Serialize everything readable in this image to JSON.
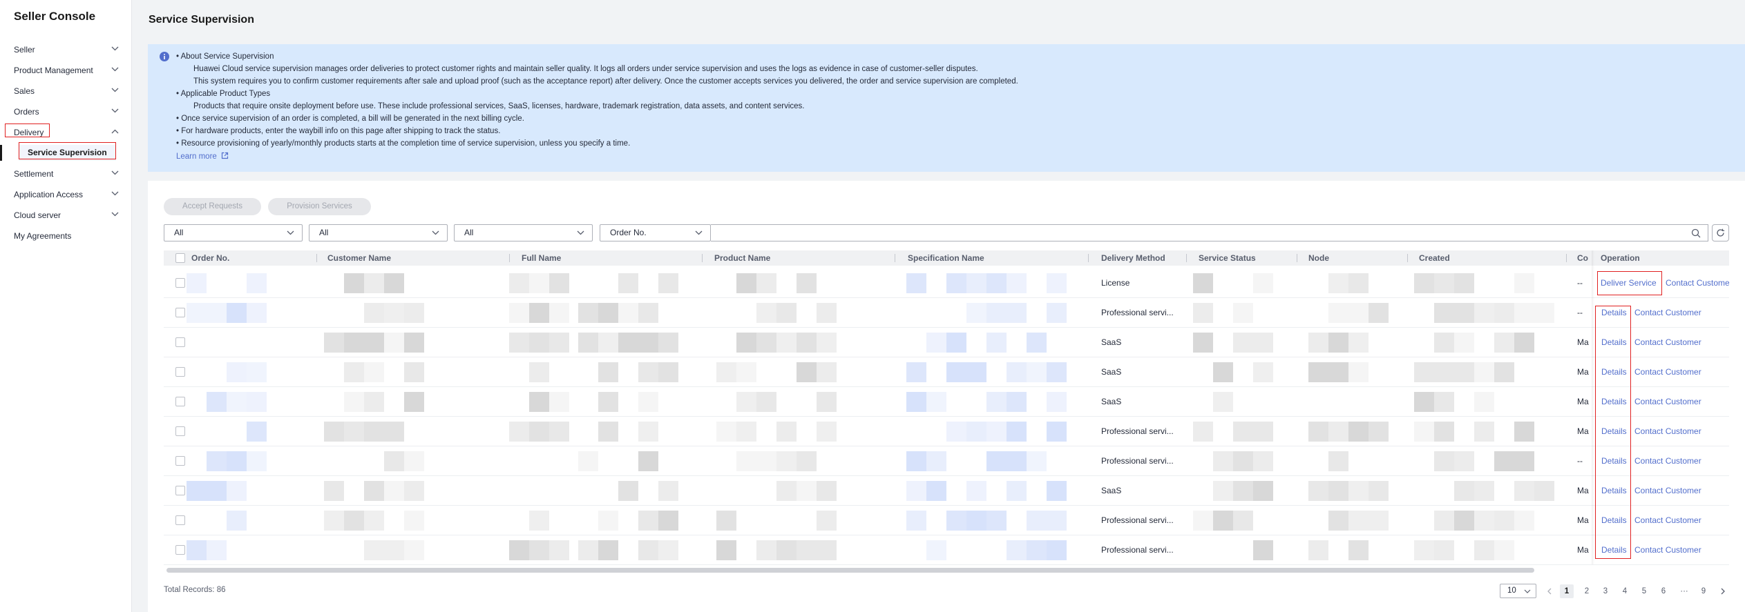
{
  "sidebar": {
    "brand": "Seller Console",
    "items": [
      {
        "label": "Seller"
      },
      {
        "label": "Product Management"
      },
      {
        "label": "Sales"
      },
      {
        "label": "Orders"
      },
      {
        "label": "Delivery"
      },
      {
        "label": "Service Supervision"
      },
      {
        "label": "Settlement"
      },
      {
        "label": "Application Access"
      },
      {
        "label": "Cloud server"
      },
      {
        "label": "My Agreements"
      }
    ]
  },
  "page": {
    "title": "Service Supervision"
  },
  "info": {
    "lines": [
      "• About Service Supervision",
      "Huawei Cloud service supervision manages order deliveries to protect customer rights and maintain seller quality. It logs all orders under service supervision and uses the logs as evidence in case of customer-seller disputes.",
      "This system requires you to confirm customer requirements after sale and upload proof (such as the acceptance report) after delivery. Once the customer accepts services you delivered, the order and service supervision are completed.",
      "• Applicable Product Types",
      "Products that require onsite deployment before use. These include professional services, SaaS, licenses, hardware, trademark registration, data assets, and content services.",
      "• Once service supervision of an order is completed, a bill will be generated in the next billing cycle.",
      "• For hardware products, enter the waybill info on this page after shipping to track the status.",
      "• Resource provisioning of yearly/monthly products starts at the completion time of service supervision, unless you specify a time."
    ],
    "learn_more": "Learn more"
  },
  "toolbar": {
    "accept_label": "Accept Requests",
    "provision_label": "Provision Services",
    "filter1": "All",
    "filter2": "All",
    "filter3": "All",
    "search_field": "Order No."
  },
  "table": {
    "columns": [
      "Order No.",
      "Customer Name",
      "Full Name",
      "Product Name",
      "Specification Name",
      "Delivery Method",
      "Service Status",
      "Node",
      "Created",
      "Co",
      "Operation"
    ],
    "rows": [
      {
        "delivery": "License",
        "co": "--",
        "op1": "Deliver Service",
        "op2": "Contact Custome"
      },
      {
        "delivery": "Professional servi...",
        "co": "--",
        "op1": "Details",
        "op2": "Contact Customer"
      },
      {
        "delivery": "SaaS",
        "co": "Ma",
        "op1": "Details",
        "op2": "Contact Customer"
      },
      {
        "delivery": "SaaS",
        "co": "Ma",
        "op1": "Details",
        "op2": "Contact Customer"
      },
      {
        "delivery": "SaaS",
        "co": "Ma",
        "op1": "Details",
        "op2": "Contact Customer"
      },
      {
        "delivery": "Professional servi...",
        "co": "Ma",
        "op1": "Details",
        "op2": "Contact Customer"
      },
      {
        "delivery": "Professional servi...",
        "co": "--",
        "op1": "Details",
        "op2": "Contact Customer"
      },
      {
        "delivery": "SaaS",
        "co": "Ma",
        "op1": "Details",
        "op2": "Contact Customer"
      },
      {
        "delivery": "Professional servi...",
        "co": "Ma",
        "op1": "Details",
        "op2": "Contact Customer"
      },
      {
        "delivery": "Professional servi...",
        "co": "Ma",
        "op1": "Details",
        "op2": "Contact Customer"
      }
    ]
  },
  "footer": {
    "total": "Total Records: 86",
    "page_size": "10",
    "pages": [
      "1",
      "2",
      "3",
      "4",
      "5",
      "6",
      "···",
      "9"
    ],
    "current_page": 1
  },
  "colors": {
    "accent": "#526ecc",
    "highlight": "#e02020",
    "info_bg": "#d8e9fd"
  },
  "icons": [
    "chevron-down-icon",
    "chevron-up-icon",
    "info-icon",
    "external-link-icon",
    "search-icon",
    "refresh-icon",
    "chevron-left-icon",
    "chevron-right-icon"
  ]
}
